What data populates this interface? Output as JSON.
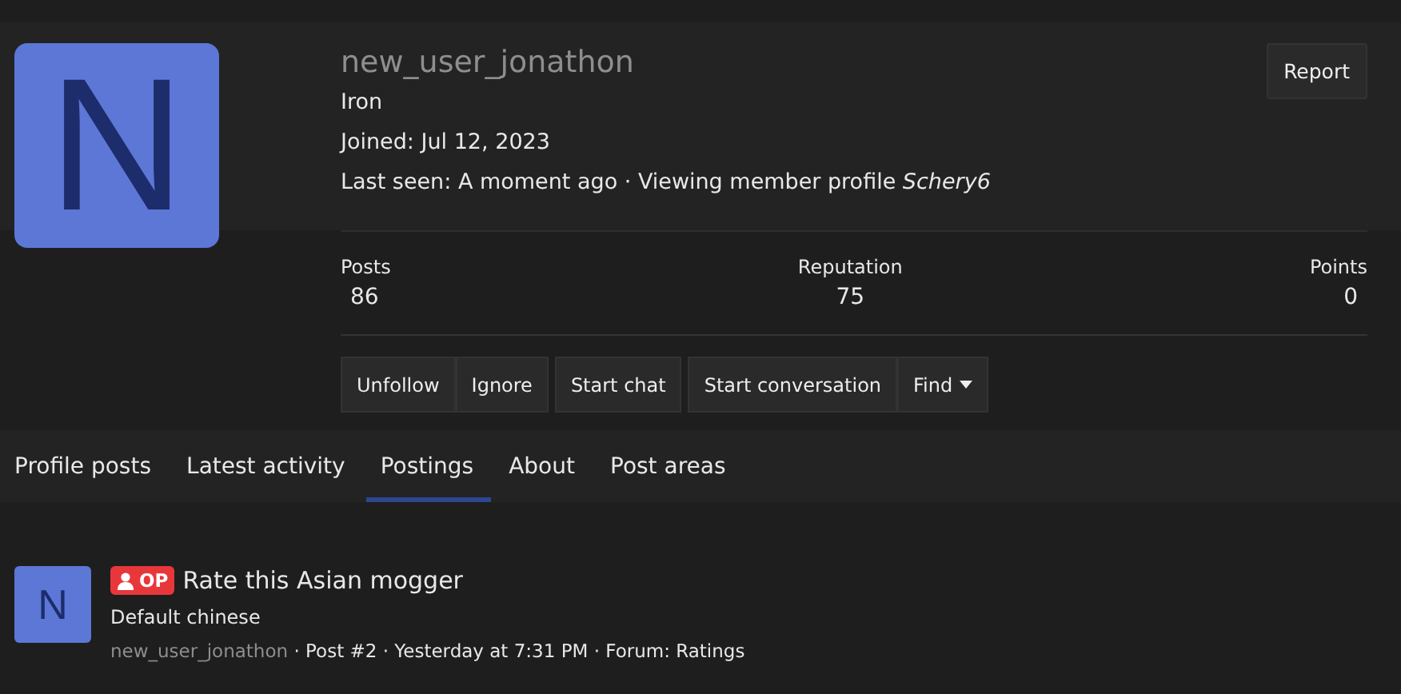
{
  "profile": {
    "avatar_letter": "N",
    "username": "new_user_jonathon",
    "rank": "Iron",
    "joined": "Joined: Jul 12, 2023",
    "last_seen": "Last seen: A moment ago · Viewing member profile *Schery6*",
    "report": "Report"
  },
  "stats": [
    {
      "label": "Posts",
      "value": "86"
    },
    {
      "label": "Reputation",
      "value": "75"
    },
    {
      "label": "Points",
      "value": "0"
    }
  ],
  "action_groups": [
    [
      {
        "label": "Unfollow"
      },
      {
        "label": "Ignore"
      }
    ],
    [
      {
        "label": "Start chat"
      }
    ],
    [
      {
        "label": "Start conversation"
      },
      {
        "label": "Find",
        "dropdown": true
      }
    ]
  ],
  "tabs": [
    {
      "label": "Profile posts",
      "selected": false
    },
    {
      "label": "Latest activity",
      "selected": false
    },
    {
      "label": "Postings",
      "selected": true
    },
    {
      "label": "About",
      "selected": false
    },
    {
      "label": "Post areas",
      "selected": false
    }
  ],
  "posts": [
    {
      "avatar_letter": "N",
      "badge": "OP",
      "title": "Rate this Asian mogger",
      "snippet": "Default chinese",
      "author": "new_user_jonathon",
      "meta": " · Post #2 · Yesterday at 7:31 PM · Forum: Ratings"
    }
  ]
}
